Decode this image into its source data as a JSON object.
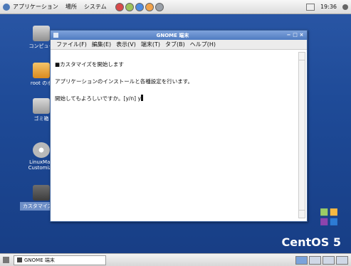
{
  "top_panel": {
    "apps_label": "アプリケーション",
    "places_label": "場所",
    "system_label": "システム",
    "clock": "19:36"
  },
  "desktop_icons": [
    {
      "label": "コンピュー"
    },
    {
      "label": "root のホ"
    },
    {
      "label": "ゴミ箱"
    },
    {
      "label": "LinuxMag Customize"
    },
    {
      "label": "カスタマイズ sh"
    }
  ],
  "window": {
    "title": "GNOME 端末",
    "menu": [
      "ファイル(F)",
      "編集(E)",
      "表示(V)",
      "端末(T)",
      "タブ(B)",
      "ヘルプ(H)"
    ],
    "lines": [
      "■カスタマイズを開始します",
      "アプリケーションのインストールと各種設定を行います。",
      "開始してもよろしいですか。[y/n] y"
    ]
  },
  "bottom_panel": {
    "task_label": "GNOME 端末"
  },
  "branding": {
    "logo_text": "CentOS 5"
  },
  "colors": {
    "desktop": "#1e4a97",
    "titlebar": "#5b84c7",
    "accent": "#7aa3db"
  }
}
